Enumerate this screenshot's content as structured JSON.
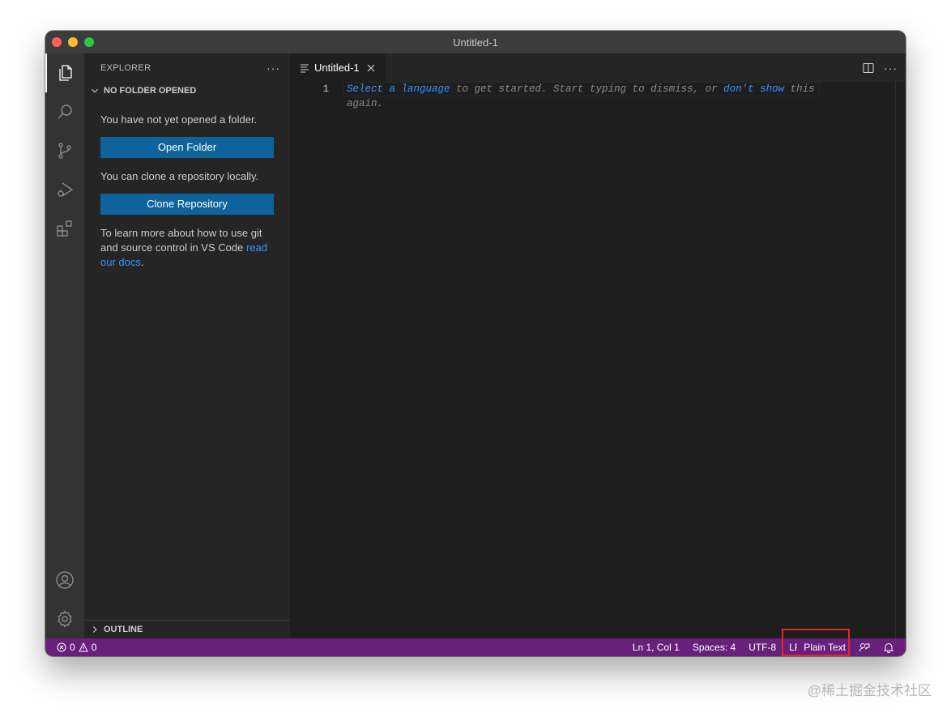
{
  "window": {
    "title": "Untitled-1"
  },
  "activity_bar": {
    "items": [
      "explorer-icon",
      "search-icon",
      "source-control-icon",
      "run-debug-icon",
      "extensions-icon"
    ],
    "bottom_items": [
      "account-icon",
      "manage-gear-icon"
    ]
  },
  "sidebar": {
    "title": "EXPLORER",
    "more": "···",
    "section_title": "NO FOLDER OPENED",
    "no_folder_text": "You have not yet opened a folder.",
    "open_folder_label": "Open Folder",
    "clone_text": "You can clone a repository locally.",
    "clone_label": "Clone Repository",
    "learn_text": "To learn more about how to use git and source control in VS Code ",
    "docs_link": "read our docs",
    "learn_end": ".",
    "outline_title": "OUTLINE"
  },
  "editor": {
    "tab_label": "Untitled-1",
    "more": "···",
    "line_number": "1",
    "hint": {
      "select_language": "Select a language",
      "middle": " to get started. Start typing to dismiss, or ",
      "dont_show": "don't show",
      "end": " this again."
    }
  },
  "statusbar": {
    "errors": "0",
    "warnings": "0",
    "position": "Ln 1, Col 1",
    "spaces": "Spaces: 4",
    "encoding": "UTF-8",
    "eol": "LF",
    "language": "Plain Text"
  },
  "watermark": "@稀土掘金技术社区",
  "colors": {
    "statusbar": "#68217a",
    "button": "#0e639c",
    "link": "#3794ff",
    "annotation_box": "#e5252a"
  }
}
